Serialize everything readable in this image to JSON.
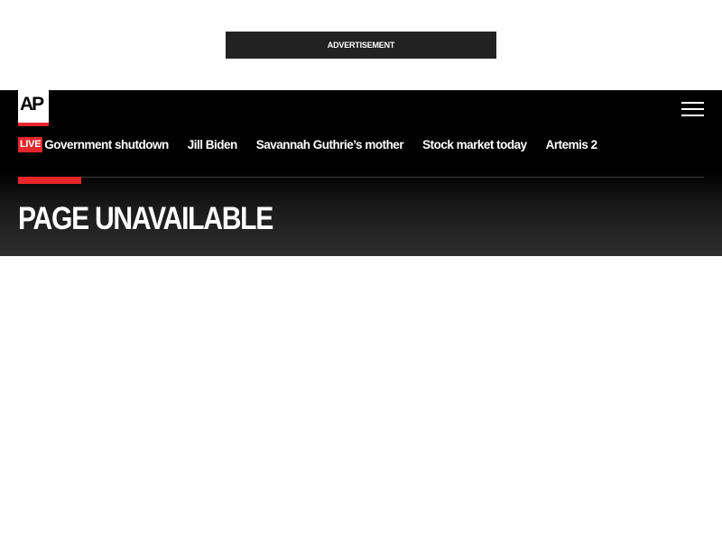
{
  "ad": {
    "label": "ADVERTISEMENT"
  },
  "header": {
    "logo_text": "AP",
    "menu_icon": "hamburger-menu-icon"
  },
  "nav": {
    "live_label": "LIVE",
    "links": [
      "Government shutdown",
      "Jill Biden",
      "Savannah Guthrie’s mother",
      "Stock market today",
      "Artemis 2"
    ]
  },
  "page": {
    "title": "PAGE UNAVAILABLE"
  },
  "colors": {
    "accent": "#e8262b",
    "masthead": "#000000",
    "ad_banner": "#222222"
  }
}
